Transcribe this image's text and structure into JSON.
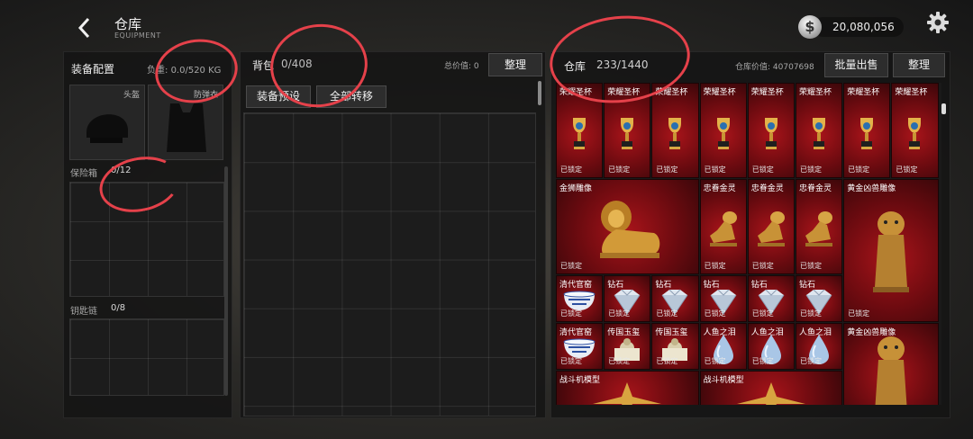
{
  "header": {
    "title": "仓库",
    "subtitle": "EQUIPMENT",
    "money": "20,080,056",
    "coin_symbol": "$"
  },
  "equipment": {
    "title": "装备配置",
    "weight_label": "负重:",
    "weight_value": "0.0/520 KG",
    "slots": [
      {
        "label": "头盔",
        "icon": "helmet-icon"
      },
      {
        "label": "防弹衣",
        "icon": "vest-icon"
      }
    ],
    "safebox_label": "保险箱",
    "safebox_count": "0/12",
    "keychain_label": "钥匙链",
    "keychain_count": "0/8"
  },
  "backpack": {
    "title": "背包",
    "count": "0/408",
    "total_label": "总价值:",
    "total_value": "0",
    "sort_label": "整理",
    "preset_label": "装备预设",
    "move_all_label": "全部转移"
  },
  "warehouse": {
    "title": "仓库",
    "count": "233/1440",
    "value_label": "仓库价值:",
    "value": "40707698",
    "bulk_sell_label": "批量出售",
    "sort_label": "整理",
    "lock_text": "已锁定",
    "items": [
      {
        "name": "荣耀圣杯",
        "icon": "trophy-icon"
      },
      {
        "name": "荣耀圣杯",
        "icon": "trophy-icon"
      },
      {
        "name": "荣耀圣杯",
        "icon": "trophy-icon"
      },
      {
        "name": "荣耀圣杯",
        "icon": "trophy-icon"
      },
      {
        "name": "荣耀圣杯",
        "icon": "trophy-icon"
      },
      {
        "name": "荣耀圣杯",
        "icon": "trophy-icon"
      },
      {
        "name": "荣耀圣杯",
        "icon": "trophy-icon"
      },
      {
        "name": "荣耀圣杯",
        "icon": "trophy-icon"
      },
      {
        "name": "金狮雕像",
        "icon": "lion-statue-icon"
      },
      {
        "name": "忠眷金灵",
        "icon": "golden-dog-icon"
      },
      {
        "name": "忠眷金灵",
        "icon": "golden-dog-icon"
      },
      {
        "name": "忠眷金灵",
        "icon": "golden-dog-icon"
      },
      {
        "name": "黄金凶兽雕像",
        "icon": "golden-beast-icon"
      },
      {
        "name": "清代官窑",
        "icon": "porcelain-bowl-icon"
      },
      {
        "name": "钻石",
        "icon": "diamond-icon"
      },
      {
        "name": "钻石",
        "icon": "diamond-icon"
      },
      {
        "name": "钻石",
        "icon": "diamond-icon"
      },
      {
        "name": "钻石",
        "icon": "diamond-icon"
      },
      {
        "name": "钻石",
        "icon": "diamond-icon"
      },
      {
        "name": "清代官窑",
        "icon": "porcelain-bowl-icon"
      },
      {
        "name": "传国玉玺",
        "icon": "jade-seal-icon"
      },
      {
        "name": "传国玉玺",
        "icon": "jade-seal-icon"
      },
      {
        "name": "人鱼之泪",
        "icon": "tear-gem-icon"
      },
      {
        "name": "人鱼之泪",
        "icon": "tear-gem-icon"
      },
      {
        "name": "人鱼之泪",
        "icon": "tear-gem-icon"
      },
      {
        "name": "黄金凶兽雕像",
        "icon": "golden-beast-icon"
      },
      {
        "name": "战斗机模型",
        "icon": "jet-model-icon"
      },
      {
        "name": "战斗机模型",
        "icon": "jet-model-icon"
      }
    ]
  },
  "colors": {
    "annotation": "#e5414a",
    "item_red": "#8c1016",
    "gold": "#d4a640"
  }
}
